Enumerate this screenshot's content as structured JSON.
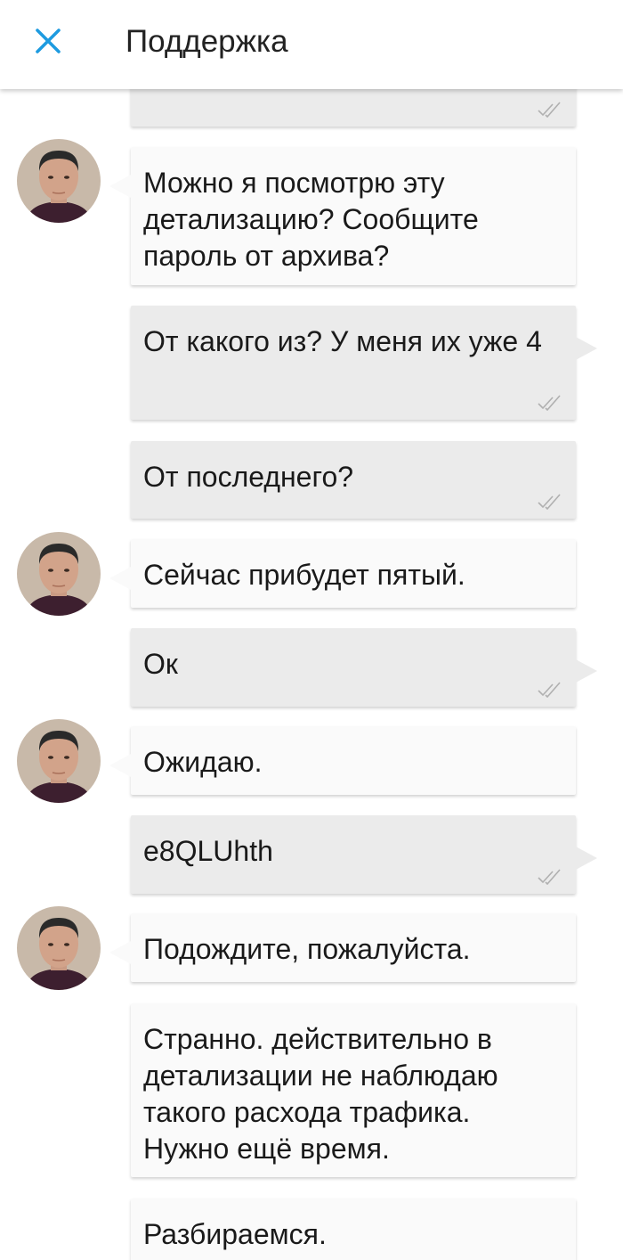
{
  "header": {
    "title": "Поддержка",
    "close_icon": "close-icon"
  },
  "colors": {
    "accent": "#1e9be0",
    "incoming_bubble": "#fafafa",
    "outgoing_bubble": "#ebebeb"
  },
  "messages": [
    {
      "from": "user",
      "text": ""
    },
    {
      "from": "support",
      "text": "Можно я посмотрю эту детализацию? Сообщите пароль от архива?"
    },
    {
      "from": "user",
      "text": "От какого из? У меня их уже 4"
    },
    {
      "from": "user",
      "text": "От последнего?"
    },
    {
      "from": "support",
      "text": "Сейчас прибудет пятый."
    },
    {
      "from": "user",
      "text": "Ок"
    },
    {
      "from": "support",
      "text": "Ожидаю."
    },
    {
      "from": "user",
      "text": "e8QLUhth"
    },
    {
      "from": "support",
      "text": "Подождите, пожалуйста."
    },
    {
      "from": "support",
      "text": "Странно. действительно в детализации не наблюдаю такого расхода трафика. Нужно ещё время."
    },
    {
      "from": "support",
      "text": "Разбираемся."
    }
  ]
}
